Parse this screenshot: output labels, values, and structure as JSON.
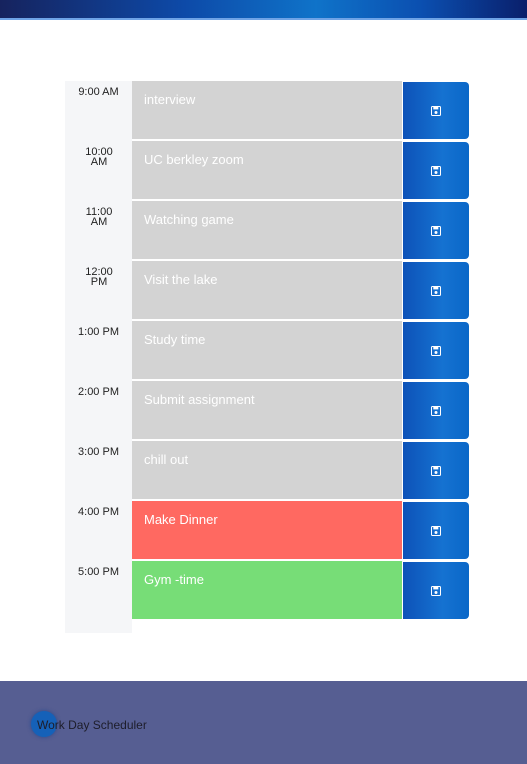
{
  "app": {
    "title": "Work Day Scheduler"
  },
  "colors": {
    "past": "#d3d3d3",
    "present": "#ff6961",
    "future": "#77dd77",
    "save_button": "#1572d1",
    "footer": "#565e92"
  },
  "rows": [
    {
      "hour": "9:00 AM",
      "event": "interview",
      "state": "past"
    },
    {
      "hour": "10:00 AM",
      "event": "UC berkley zoom",
      "state": "past"
    },
    {
      "hour": "11:00 AM",
      "event": "Watching game",
      "state": "past"
    },
    {
      "hour": "12:00 PM",
      "event": "Visit the lake",
      "state": "past"
    },
    {
      "hour": "1:00 PM",
      "event": "Study time",
      "state": "past"
    },
    {
      "hour": "2:00 PM",
      "event": "Submit assignment",
      "state": "past"
    },
    {
      "hour": "3:00 PM",
      "event": "chill out",
      "state": "past"
    },
    {
      "hour": "4:00 PM",
      "event": "Make Dinner",
      "state": "present"
    },
    {
      "hour": "5:00 PM",
      "event": "Gym -time",
      "state": "future"
    }
  ],
  "icons": {
    "save": "floppy-disk-icon"
  }
}
